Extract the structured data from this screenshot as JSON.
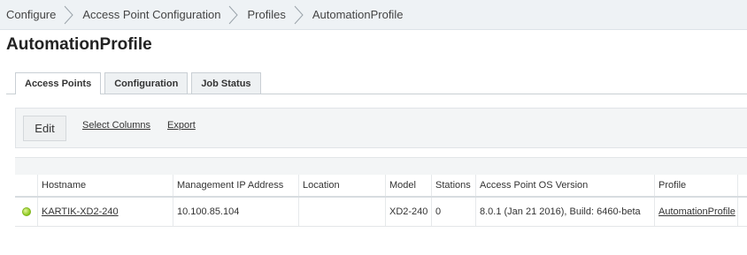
{
  "breadcrumb": {
    "items": [
      "Configure",
      "Access Point Configuration",
      "Profiles",
      "AutomationProfile"
    ]
  },
  "page": {
    "title": "AutomationProfile"
  },
  "tabs": [
    {
      "label": "Access Points",
      "active": true
    },
    {
      "label": "Configuration",
      "active": false
    },
    {
      "label": "Job Status",
      "active": false
    }
  ],
  "toolbar": {
    "edit_label": "Edit",
    "select_columns_label": "Select Columns",
    "export_label": "Export"
  },
  "table": {
    "columns": [
      "Hostname",
      "Management IP Address",
      "Location",
      "Model",
      "Stations",
      "Access Point OS Version",
      "Profile"
    ],
    "rows": [
      {
        "status": "online",
        "hostname": "KARTIK-XD2-240",
        "management_ip": "10.100.85.104",
        "location": "",
        "model": "XD2-240",
        "stations": "0",
        "os_version": "8.0.1 (Jan 21 2016), Build: 6460-beta",
        "profile": "AutomationProfile"
      }
    ]
  },
  "colors": {
    "status_online": "#8cc81e",
    "breadcrumb_bg": "#eef2f5",
    "toolbar_bg": "#f3f5f6"
  }
}
